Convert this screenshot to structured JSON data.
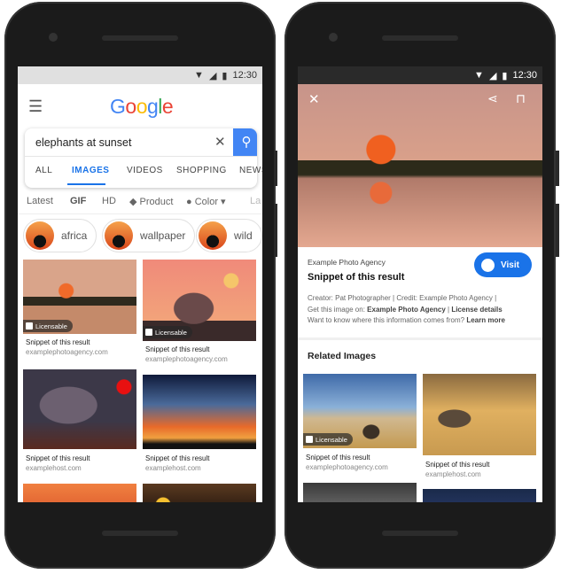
{
  "status": {
    "time": "12:30"
  },
  "left": {
    "logo": "Google",
    "search": {
      "value": "elephants at sunset"
    },
    "tabs": [
      "ALL",
      "IMAGES",
      "VIDEOS",
      "SHOPPING",
      "NEWS"
    ],
    "active_tab": "IMAGES",
    "filters": [
      "Latest",
      "GIF",
      "HD",
      "Product",
      "Color",
      "La"
    ],
    "chips": [
      "africa",
      "wallpaper",
      "wild"
    ],
    "results": [
      {
        "snippet": "Snippet of this result",
        "source": "examplephotoagency.com",
        "badge": "Licensable"
      },
      {
        "snippet": "Snippet of this result",
        "source": "examplephotoagency.com",
        "badge": "Licensable"
      },
      {
        "snippet": "Snippet of this result",
        "source": "examplehost.com"
      },
      {
        "snippet": "Snippet of this result",
        "source": "examplehost.com"
      }
    ]
  },
  "right": {
    "agency": "Example Photo Agency",
    "title": "Snippet of this result",
    "visit": "Visit",
    "line1": "Creator: Pat Photographer | Credit: Example Photo Agency |",
    "line2_prefix": "Get this image on: ",
    "line2_link1": "Example Photo Agency",
    "line2_sep": " | ",
    "line2_link2": "License details",
    "line3_prefix": "Want to know where this information comes from? ",
    "line3_link": "Learn more",
    "related_heading": "Related Images",
    "related": [
      {
        "snippet": "Snippet of this result",
        "source": "examplephotoagency.com",
        "badge": "Licensable"
      },
      {
        "snippet": "Snippet of this result",
        "source": "examplehost.com"
      }
    ]
  },
  "colors": {
    "accent": "#1a73e8",
    "search_button": "#4285f4"
  }
}
